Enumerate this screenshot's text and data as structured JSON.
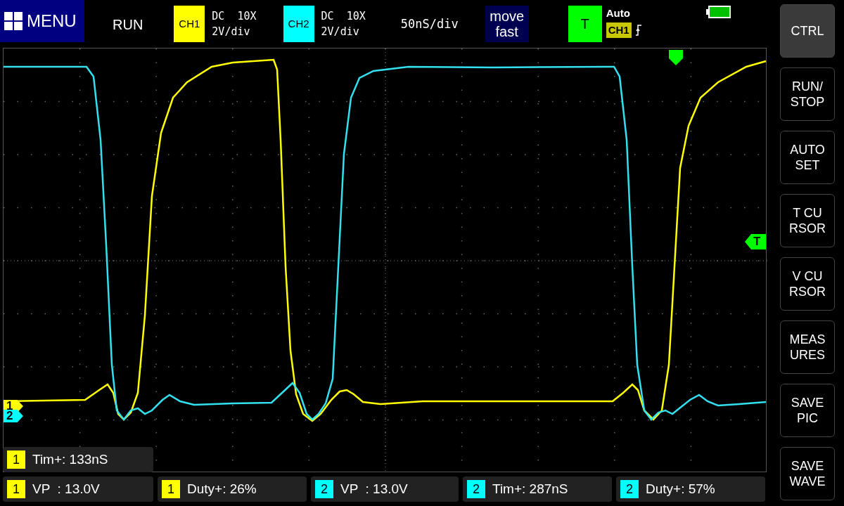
{
  "top_bar": {
    "menu_label": "MENU",
    "run_state": "RUN",
    "channels": [
      {
        "badge": "CH1",
        "color": "#ffff00",
        "coupling": "DC  10X",
        "scale": "2V/div"
      },
      {
        "badge": "CH2",
        "color": "#00ffff",
        "coupling": "DC  10X",
        "scale": "2V/div"
      }
    ],
    "timebase": "50nS/div",
    "move_mode": "move fast",
    "trigger": {
      "badge": "T",
      "mode": "Auto",
      "source": "CH1"
    }
  },
  "screen": {
    "channel_markers": [
      {
        "label": "1",
        "color": "#ffff00"
      },
      {
        "label": "2",
        "color": "#00ffff"
      }
    ],
    "trigger_level_marker": "T"
  },
  "measurements": [
    {
      "items": [
        {
          "channel": "1",
          "color": "#ffff00",
          "text": "Tim+: 133nS"
        }
      ]
    },
    {
      "items": [
        {
          "channel": "1",
          "color": "#ffff00",
          "text": "VP  : 13.0V"
        },
        {
          "channel": "1",
          "color": "#ffff00",
          "text": "Duty+: 26%"
        },
        {
          "channel": "2",
          "color": "#00ffff",
          "text": "VP  : 13.0V"
        },
        {
          "channel": "2",
          "color": "#00ffff",
          "text": "Tim+: 287nS"
        },
        {
          "channel": "2",
          "color": "#00ffff",
          "text": "Duty+: 57%"
        }
      ]
    }
  ],
  "side_buttons": [
    {
      "label": "CTRL",
      "selected": true
    },
    {
      "label": "RUN/\nSTOP",
      "selected": false
    },
    {
      "label": "AUTO\nSET",
      "selected": false
    },
    {
      "label": "T CU\nRSOR",
      "selected": false
    },
    {
      "label": "V CU\nRSOR",
      "selected": false
    },
    {
      "label": "MEAS\nURES",
      "selected": false
    },
    {
      "label": "SAVE\nPIC",
      "selected": false
    },
    {
      "label": "SAVE\nWAVE",
      "selected": false
    }
  ]
}
